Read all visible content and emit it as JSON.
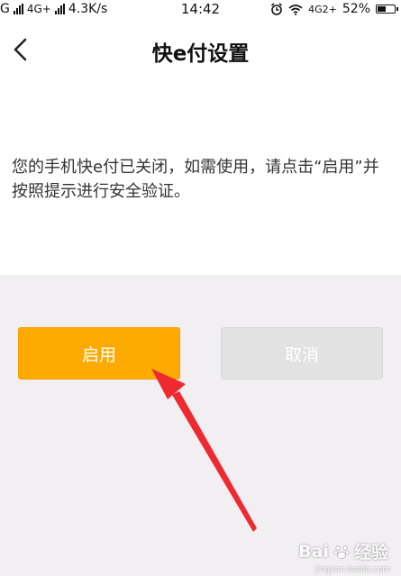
{
  "status_bar": {
    "carrier_fragment": "G",
    "network_type": "4G+",
    "speed": "4.3K/s",
    "time": "14:42",
    "network_type_right": "4G2+",
    "battery": "52%",
    "battery_level": 0.52
  },
  "header": {
    "title": "快e付设置"
  },
  "content": {
    "message": "您的手机快e付已关闭，如需使用，请点击“启用”并按照提示进行安全验证。"
  },
  "buttons": {
    "enable_label": "启用",
    "cancel_label": "取消"
  },
  "watermark": {
    "brand": "Bai",
    "brand_suffix": "经验",
    "url": "jingyan.baidu.com"
  },
  "colors": {
    "enable_button": "#ffaa00",
    "cancel_button": "#e2e2e2",
    "background": "#f1eff2",
    "annotation_arrow": "#ee2a30"
  }
}
